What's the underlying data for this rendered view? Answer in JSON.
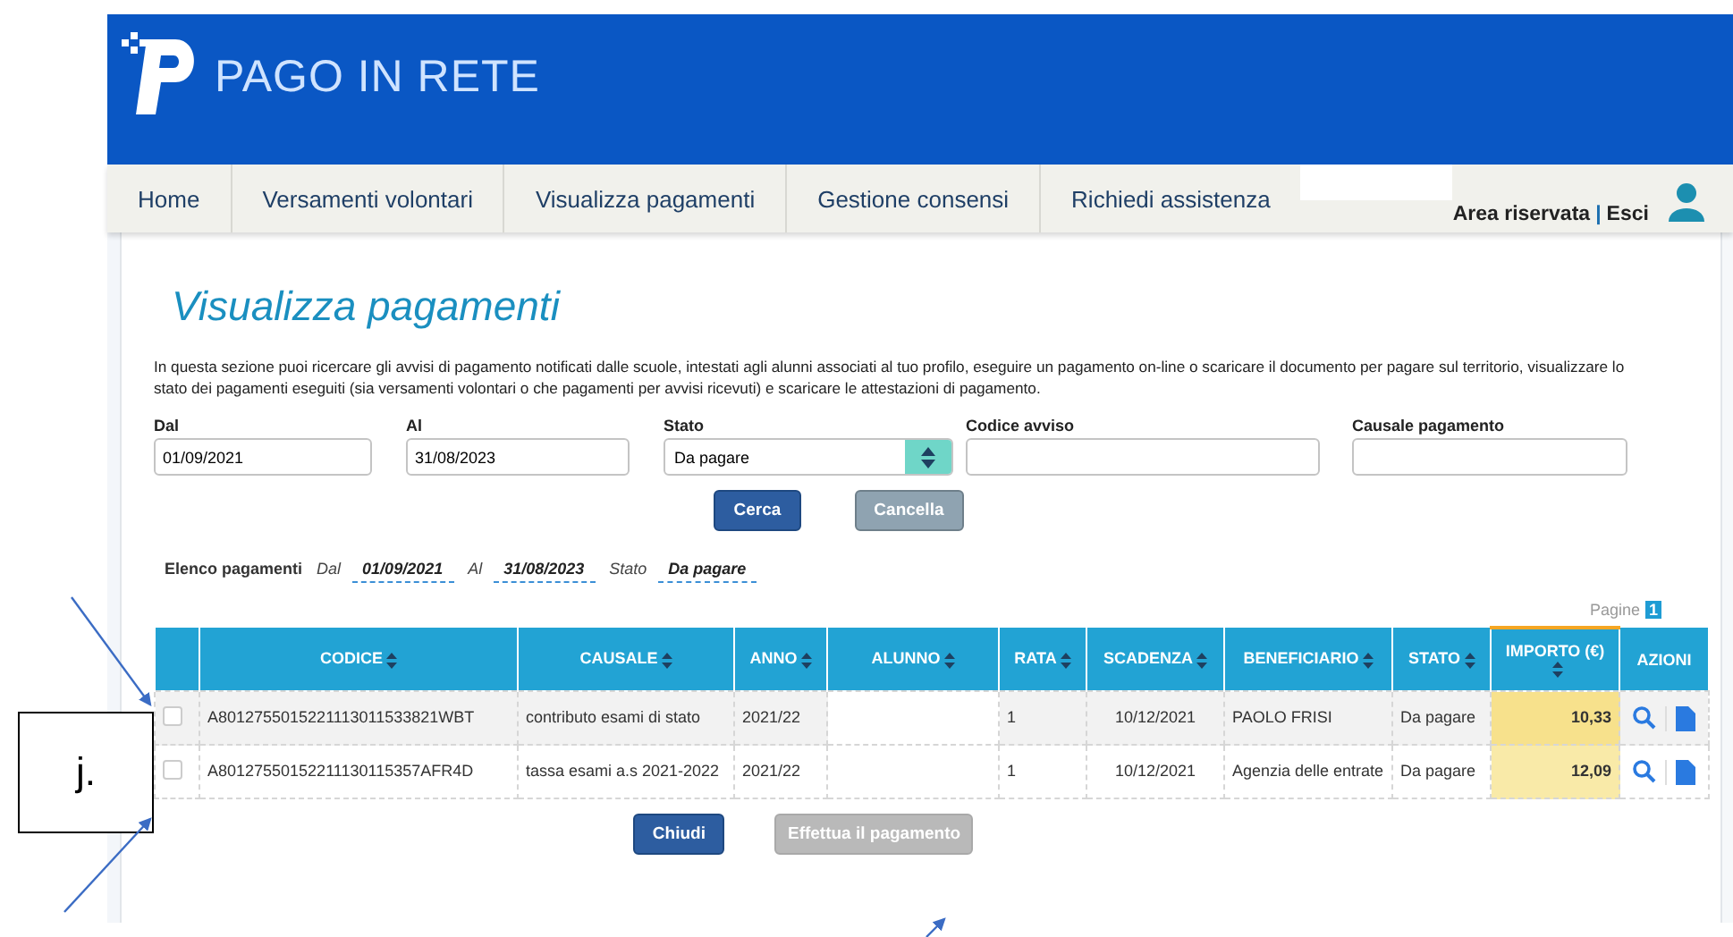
{
  "header": {
    "logo_text": "PAGO IN RETE"
  },
  "nav": {
    "items": [
      {
        "label": "Home"
      },
      {
        "label": "Versamenti volontari"
      },
      {
        "label": "Visualizza pagamenti"
      },
      {
        "label": "Gestione consensi"
      },
      {
        "label": "Richiedi assistenza"
      }
    ],
    "area": "Area riservata",
    "separator": "|",
    "logout": "Esci"
  },
  "page": {
    "title": "Visualizza pagamenti",
    "description": "In questa sezione puoi ricercare gli avvisi di pagamento notificati dalle scuole, intestati agli alunni associati al tuo profilo, eseguire un pagamento on-line o scaricare il documento per pagare sul territorio, visualizzare lo stato dei pagamenti eseguiti (sia versamenti volontari o che pagamenti per avvisi ricevuti) e scaricare le attestazioni di pagamento."
  },
  "filters": [
    {
      "label": "Dal",
      "value": "01/09/2021",
      "kind": "text"
    },
    {
      "label": "Al",
      "value": "31/08/2023",
      "kind": "text"
    },
    {
      "label": "Stato",
      "value": "Da pagare",
      "kind": "select"
    },
    {
      "label": "Codice avviso",
      "kind": "text"
    },
    {
      "label": "Causale pagamento",
      "kind": "text"
    }
  ],
  "search_buttons": [
    {
      "label": "Cerca",
      "disabled": false
    },
    {
      "label": "Cancella",
      "disabled": true
    }
  ],
  "summary": {
    "title": "Elenco pagamenti",
    "items": [
      {
        "label": "Dal",
        "value": "01/09/2021"
      },
      {
        "label": "Al",
        "value": "31/08/2023"
      },
      {
        "label": "Stato",
        "value": "Da pagare"
      }
    ]
  },
  "pager": {
    "label": "Pagine",
    "page": "1"
  },
  "table": {
    "columns": [
      {
        "label": "CODICE",
        "sortable": true
      },
      {
        "label": "CAUSALE",
        "sortable": true
      },
      {
        "label": "ANNO",
        "sortable": true
      },
      {
        "label": "ALUNNO",
        "sortable": true
      },
      {
        "label": "RATA",
        "sortable": true
      },
      {
        "label": "SCADENZA",
        "sortable": true
      },
      {
        "label": "BENEFICIARIO",
        "sortable": true
      },
      {
        "label": "STATO",
        "sortable": true
      },
      {
        "label": "IMPORTO (€)",
        "sortable": true
      },
      {
        "label": "AZIONI",
        "sortable": false
      }
    ],
    "rows": [
      {
        "checked": false,
        "cells": [
          "A80127550152211130115338​21WBT",
          "contributo esami di stato",
          "2021/22",
          "",
          "1",
          "10/12/2021",
          "PAOLO FRISI",
          "Da pagare",
          "10,33"
        ]
      },
      {
        "checked": false,
        "cells": [
          "A80127550152211130115357AFR4D",
          "tassa esami a.s 2021-2022",
          "2021/22",
          "",
          "1",
          "10/12/2021",
          "Agenzia delle entrate",
          "Da pagare",
          "12,09"
        ]
      }
    ]
  },
  "bottom_buttons": [
    {
      "label": "Chiudi",
      "disabled": false
    },
    {
      "label": "Effettua il pagamento",
      "disabled": true
    }
  ],
  "annotation": {
    "label": "j."
  }
}
